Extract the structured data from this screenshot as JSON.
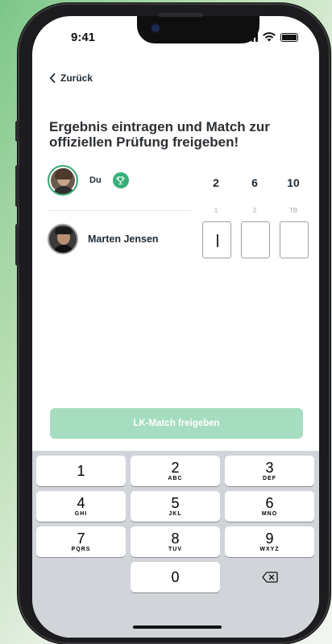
{
  "status": {
    "time": "9:41"
  },
  "nav": {
    "back_label": "Zurück"
  },
  "header": {
    "title": "Ergebnis eintragen und Match zur offiziellen Prüfung freigeben!"
  },
  "players": [
    {
      "name": "Du",
      "is_winner": true,
      "scores": [
        "2",
        "6",
        "10"
      ]
    },
    {
      "name": "Marten Jensen",
      "inputs": [
        "",
        "",
        ""
      ]
    }
  ],
  "set_labels": [
    "1",
    "2",
    "TB"
  ],
  "cta": {
    "label": "LK-Match freigeben"
  },
  "keypad": {
    "keys": [
      {
        "num": "1",
        "letters": ""
      },
      {
        "num": "2",
        "letters": "ABC"
      },
      {
        "num": "3",
        "letters": "DEF"
      },
      {
        "num": "4",
        "letters": "GHI"
      },
      {
        "num": "5",
        "letters": "JKL"
      },
      {
        "num": "6",
        "letters": "MNO"
      },
      {
        "num": "7",
        "letters": "PQRS"
      },
      {
        "num": "8",
        "letters": "TUV"
      },
      {
        "num": "9",
        "letters": "WXYZ"
      },
      {
        "num": "0",
        "letters": ""
      }
    ]
  },
  "colors": {
    "accent": "#35b07a",
    "cta_disabled": "#a6dcbf",
    "keypad_bg": "#d1d4d9"
  },
  "icons": [
    "back-chevron-icon",
    "trophy-icon",
    "signal-icon",
    "wifi-icon",
    "battery-icon",
    "backspace-icon"
  ]
}
